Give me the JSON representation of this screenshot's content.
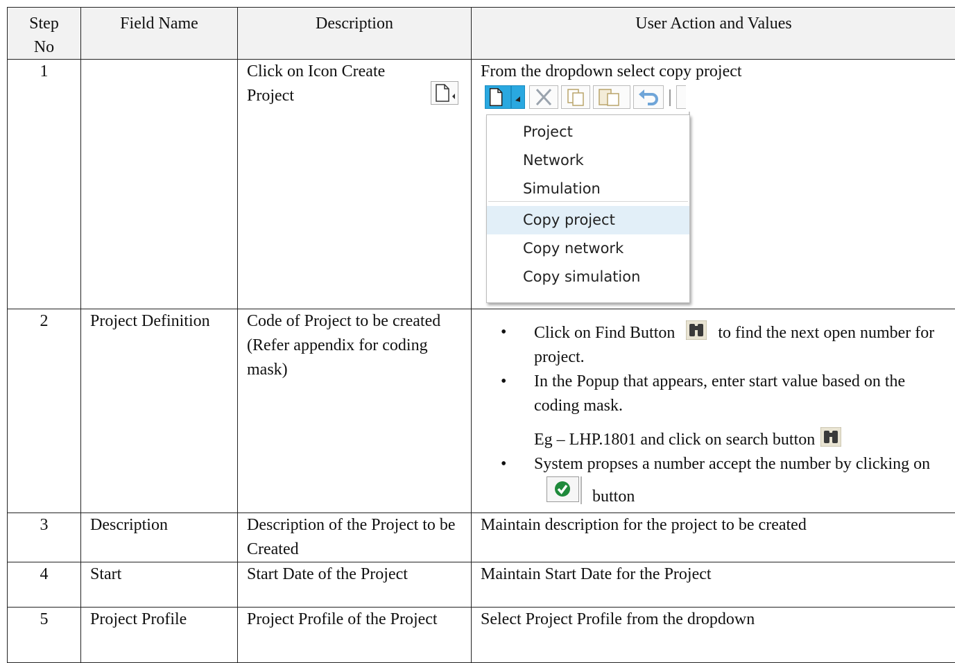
{
  "table": {
    "headers": [
      "Step No",
      "Field Name",
      "Description",
      "User Action and Values"
    ],
    "rows": [
      {
        "step": "1",
        "field": "",
        "desc": "Click on Icon Create Project",
        "action": "From the dropdown select copy project"
      },
      {
        "step": "2",
        "field": "Project Definition",
        "desc": "Code of Project to be created (Refer appendix for coding mask)",
        "bullets": [
          {
            "pre": "Click on Find Button",
            "post": "to find the next open number for project."
          },
          {
            "text": "In the Popup that appears, enter start value based on the coding mask."
          },
          {
            "sub": "Eg – LHP.1801 and click on search button"
          },
          {
            "pre": "System propses a number accept the number by clicking on",
            "post": "button"
          }
        ]
      },
      {
        "step": "3",
        "field": "Description",
        "desc": "Description of the Project to be Created",
        "action": "Maintain description for the project to be created"
      },
      {
        "step": "4",
        "field": "Start",
        "desc": "Start Date of the Project",
        "action": "Maintain Start Date for the Project"
      },
      {
        "step": "5",
        "field": "Project Profile",
        "desc": "Project Profile of the Project",
        "action": "Select Project Profile from the dropdown"
      }
    ]
  },
  "dropdown": {
    "items": [
      "Project",
      "Network",
      "Simulation",
      "Copy project",
      "Copy network",
      "Copy simulation"
    ],
    "highlighted": "Copy project"
  },
  "icons": {
    "new": "new-document-icon",
    "find": "binoculars-icon",
    "accept": "green-check-icon"
  },
  "colors": {
    "toolbar_active": "#2aa8e0",
    "menu_highlight": "#e2eff8",
    "accept": "#1f8a3b"
  }
}
